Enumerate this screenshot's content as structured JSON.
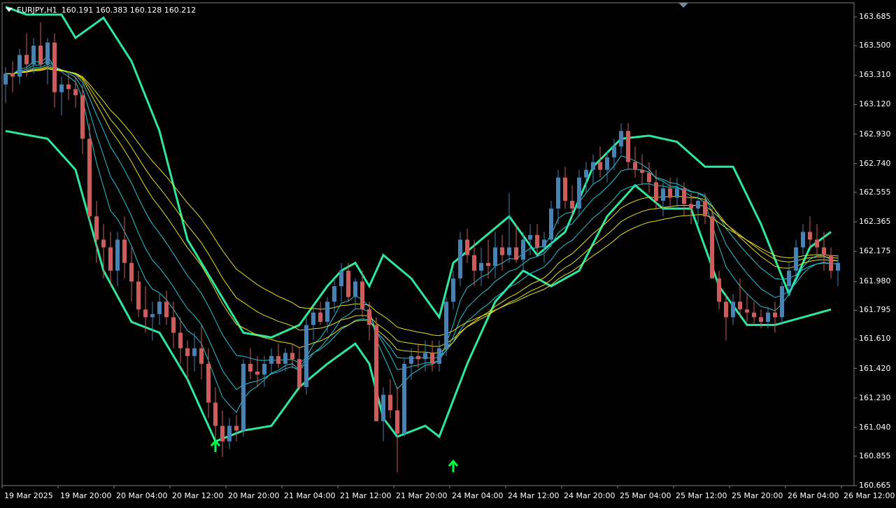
{
  "header": {
    "symbol": "EURJPY,H1",
    "ohlc": "160.191 160.383 160.128 160.212"
  },
  "colors": {
    "background": "#000000",
    "bull": "#4682b4",
    "bear": "#cd5c5c",
    "bollinger": "#2ee8a0",
    "ma_cyan": "#25c9d6",
    "ma_yellow": "#e6e020",
    "signal": "#00ff40",
    "axis": "#ffffff"
  },
  "chart_data": {
    "type": "candlestick",
    "symbol": "EURJPY",
    "timeframe": "H1",
    "ylim": [
      160.665,
      163.776
    ],
    "y_ticks": [
      "163.685",
      "163.500",
      "163.310",
      "163.120",
      "162.930",
      "162.740",
      "162.555",
      "162.365",
      "162.175",
      "161.980",
      "161.795",
      "161.610",
      "161.420",
      "161.230",
      "161.040",
      "160.855",
      "160.665"
    ],
    "x_ticks": [
      "19 Mar 2025",
      "19 Mar 20:00",
      "20 Mar 04:00",
      "20 Mar 12:00",
      "20 Mar 20:00",
      "21 Mar 04:00",
      "21 Mar 12:00",
      "21 Mar 20:00",
      "24 Mar 04:00",
      "24 Mar 12:00",
      "24 Mar 20:00",
      "25 Mar 04:00",
      "25 Mar 12:00",
      "25 Mar 20:00",
      "26 Mar 04:00",
      "26 Mar 12:00"
    ],
    "candles_ohlc": [
      [
        163.25,
        163.36,
        163.13,
        163.32
      ],
      [
        163.32,
        163.4,
        163.2,
        163.3
      ],
      [
        163.3,
        163.48,
        163.25,
        163.44
      ],
      [
        163.44,
        163.58,
        163.3,
        163.38
      ],
      [
        163.38,
        163.55,
        163.32,
        163.5
      ],
      [
        163.5,
        163.65,
        163.35,
        163.38
      ],
      [
        163.38,
        163.55,
        163.25,
        163.52
      ],
      [
        163.52,
        163.58,
        163.1,
        163.2
      ],
      [
        163.2,
        163.3,
        163.05,
        163.25
      ],
      [
        163.25,
        163.32,
        163.15,
        163.22
      ],
      [
        163.22,
        163.3,
        163.1,
        163.18
      ],
      [
        163.18,
        163.25,
        162.8,
        162.9
      ],
      [
        162.9,
        163.0,
        162.35,
        162.4
      ],
      [
        162.4,
        162.5,
        162.1,
        162.25
      ],
      [
        162.25,
        162.35,
        162.0,
        162.2
      ],
      [
        162.2,
        162.3,
        161.95,
        162.05
      ],
      [
        162.05,
        162.3,
        161.95,
        162.25
      ],
      [
        162.25,
        162.4,
        162.0,
        162.1
      ],
      [
        162.1,
        162.2,
        161.85,
        161.98
      ],
      [
        161.98,
        162.05,
        161.75,
        161.8
      ],
      [
        161.8,
        161.95,
        161.65,
        161.75
      ],
      [
        161.75,
        161.85,
        161.6,
        161.77
      ],
      [
        161.77,
        161.9,
        161.7,
        161.85
      ],
      [
        161.85,
        161.92,
        161.7,
        161.75
      ],
      [
        161.75,
        161.85,
        161.55,
        161.65
      ],
      [
        161.65,
        161.75,
        161.45,
        161.55
      ],
      [
        161.55,
        161.6,
        161.35,
        161.5
      ],
      [
        161.5,
        161.65,
        161.4,
        161.55
      ],
      [
        161.55,
        161.7,
        161.35,
        161.45
      ],
      [
        161.45,
        161.55,
        161.1,
        161.2
      ],
      [
        161.2,
        161.3,
        160.95,
        161.05
      ],
      [
        161.05,
        161.15,
        160.85,
        160.95
      ],
      [
        160.95,
        161.1,
        160.9,
        161.05
      ],
      [
        161.05,
        161.12,
        160.95,
        161.02
      ],
      [
        161.02,
        161.48,
        160.98,
        161.45
      ],
      [
        161.45,
        161.55,
        161.35,
        161.4
      ],
      [
        161.4,
        161.5,
        161.3,
        161.38
      ],
      [
        161.38,
        161.5,
        161.3,
        161.45
      ],
      [
        161.45,
        161.55,
        161.38,
        161.5
      ],
      [
        161.5,
        161.58,
        161.42,
        161.45
      ],
      [
        161.45,
        161.55,
        161.4,
        161.52
      ],
      [
        161.52,
        161.58,
        161.42,
        161.48
      ],
      [
        161.48,
        161.55,
        161.28,
        161.3
      ],
      [
        161.3,
        161.75,
        161.25,
        161.7
      ],
      [
        161.7,
        161.82,
        161.6,
        161.78
      ],
      [
        161.78,
        161.85,
        161.7,
        161.72
      ],
      [
        161.72,
        161.88,
        161.65,
        161.85
      ],
      [
        161.85,
        162.0,
        161.78,
        161.95
      ],
      [
        161.95,
        162.1,
        161.85,
        162.05
      ],
      [
        162.05,
        162.1,
        161.85,
        161.88
      ],
      [
        161.88,
        162.0,
        161.8,
        161.98
      ],
      [
        161.98,
        162.05,
        161.75,
        161.8
      ],
      [
        161.8,
        161.85,
        161.6,
        161.7
      ],
      [
        161.7,
        161.75,
        161.3,
        161.08
      ],
      [
        161.08,
        161.3,
        160.95,
        161.25
      ],
      [
        161.25,
        161.35,
        161.1,
        161.15
      ],
      [
        161.15,
        161.3,
        160.75,
        161.0
      ],
      [
        161.0,
        161.48,
        160.98,
        161.45
      ],
      [
        161.45,
        161.55,
        161.35,
        161.5
      ],
      [
        161.5,
        161.58,
        161.42,
        161.48
      ],
      [
        161.48,
        161.6,
        161.4,
        161.52
      ],
      [
        161.52,
        161.6,
        161.4,
        161.45
      ],
      [
        161.45,
        161.6,
        161.4,
        161.55
      ],
      [
        161.55,
        161.88,
        161.5,
        161.85
      ],
      [
        161.85,
        162.05,
        161.8,
        162.0
      ],
      [
        162.0,
        162.3,
        161.95,
        162.25
      ],
      [
        162.25,
        162.32,
        162.1,
        162.15
      ],
      [
        162.15,
        162.25,
        161.95,
        162.05
      ],
      [
        162.05,
        162.2,
        161.95,
        162.1
      ],
      [
        162.1,
        162.25,
        162.0,
        162.08
      ],
      [
        162.08,
        162.3,
        162.0,
        162.2
      ],
      [
        162.2,
        162.28,
        162.05,
        162.15
      ],
      [
        162.15,
        162.55,
        162.1,
        162.2
      ],
      [
        162.2,
        162.35,
        162.1,
        162.12
      ],
      [
        162.12,
        162.3,
        162.05,
        162.25
      ],
      [
        162.25,
        162.35,
        162.15,
        162.28
      ],
      [
        162.28,
        162.35,
        162.15,
        162.2
      ],
      [
        162.2,
        162.3,
        162.1,
        162.25
      ],
      [
        162.25,
        162.5,
        162.2,
        162.45
      ],
      [
        162.45,
        162.7,
        162.35,
        162.65
      ],
      [
        162.65,
        162.72,
        162.45,
        162.5
      ],
      [
        162.5,
        162.6,
        162.4,
        162.45
      ],
      [
        162.45,
        162.7,
        162.4,
        162.65
      ],
      [
        162.65,
        162.75,
        162.55,
        162.7
      ],
      [
        162.7,
        162.8,
        162.6,
        162.75
      ],
      [
        162.75,
        162.85,
        162.65,
        162.7
      ],
      [
        162.7,
        162.82,
        162.62,
        162.78
      ],
      [
        162.78,
        162.9,
        162.7,
        162.85
      ],
      [
        162.85,
        163.0,
        162.8,
        162.95
      ],
      [
        162.95,
        163.0,
        162.7,
        162.75
      ],
      [
        162.75,
        162.85,
        162.65,
        162.7
      ],
      [
        162.7,
        162.8,
        162.6,
        162.68
      ],
      [
        162.68,
        162.75,
        162.55,
        162.62
      ],
      [
        162.62,
        162.7,
        162.45,
        162.5
      ],
      [
        162.5,
        162.62,
        162.4,
        162.58
      ],
      [
        162.58,
        162.65,
        162.45,
        162.52
      ],
      [
        162.52,
        162.65,
        162.45,
        162.58
      ],
      [
        162.58,
        162.62,
        162.4,
        162.48
      ],
      [
        162.48,
        162.55,
        162.35,
        162.45
      ],
      [
        162.45,
        162.55,
        162.35,
        162.5
      ],
      [
        162.5,
        162.55,
        162.35,
        162.4
      ],
      [
        162.4,
        162.45,
        162.0,
        162.0
      ],
      [
        162.0,
        162.05,
        161.8,
        161.85
      ],
      [
        161.85,
        161.9,
        161.6,
        161.75
      ],
      [
        161.75,
        161.9,
        161.7,
        161.85
      ],
      [
        161.85,
        162.0,
        161.75,
        161.8
      ],
      [
        161.8,
        161.9,
        161.72,
        161.78
      ],
      [
        161.78,
        161.85,
        161.7,
        161.75
      ],
      [
        161.75,
        161.8,
        161.68,
        161.72
      ],
      [
        161.72,
        161.82,
        161.68,
        161.78
      ],
      [
        161.78,
        161.85,
        161.65,
        161.75
      ],
      [
        161.75,
        161.98,
        161.7,
        161.95
      ],
      [
        161.95,
        162.1,
        161.9,
        162.05
      ],
      [
        162.05,
        162.25,
        162.0,
        162.2
      ],
      [
        162.2,
        162.35,
        162.15,
        162.3
      ],
      [
        162.3,
        162.4,
        162.2,
        162.25
      ],
      [
        162.25,
        162.35,
        162.15,
        162.2
      ],
      [
        162.2,
        162.3,
        162.05,
        162.15
      ],
      [
        162.15,
        162.2,
        162.0,
        162.05
      ],
      [
        162.05,
        162.15,
        161.95,
        162.1
      ]
    ],
    "bollinger_upper": [
      [
        0,
        163.75
      ],
      [
        3,
        163.7
      ],
      [
        8,
        163.7
      ],
      [
        10,
        163.55
      ],
      [
        14,
        163.68
      ],
      [
        18,
        163.4
      ],
      [
        22,
        162.95
      ],
      [
        24,
        162.6
      ],
      [
        26,
        162.25
      ],
      [
        30,
        161.95
      ],
      [
        34,
        161.65
      ],
      [
        38,
        161.62
      ],
      [
        42,
        161.7
      ],
      [
        46,
        161.95
      ],
      [
        48,
        162.05
      ],
      [
        50,
        162.1
      ],
      [
        52,
        161.95
      ],
      [
        54,
        162.15
      ],
      [
        58,
        162.0
      ],
      [
        62,
        161.75
      ],
      [
        64,
        162.1
      ],
      [
        68,
        162.25
      ],
      [
        72,
        162.4
      ],
      [
        76,
        162.15
      ],
      [
        80,
        162.3
      ],
      [
        84,
        162.72
      ],
      [
        88,
        162.9
      ],
      [
        92,
        162.92
      ],
      [
        96,
        162.88
      ],
      [
        100,
        162.72
      ],
      [
        104,
        162.72
      ],
      [
        108,
        162.35
      ],
      [
        112,
        161.9
      ],
      [
        115,
        162.2
      ],
      [
        118,
        162.3
      ]
    ],
    "bollinger_lower": [
      [
        0,
        162.95
      ],
      [
        6,
        162.9
      ],
      [
        10,
        162.7
      ],
      [
        14,
        162.05
      ],
      [
        18,
        161.72
      ],
      [
        22,
        161.65
      ],
      [
        26,
        161.35
      ],
      [
        30,
        160.95
      ],
      [
        34,
        161.02
      ],
      [
        38,
        161.05
      ],
      [
        42,
        161.3
      ],
      [
        46,
        161.45
      ],
      [
        50,
        161.58
      ],
      [
        52,
        161.45
      ],
      [
        54,
        161.1
      ],
      [
        56,
        160.98
      ],
      [
        60,
        161.05
      ],
      [
        62,
        160.98
      ],
      [
        66,
        161.45
      ],
      [
        70,
        161.85
      ],
      [
        74,
        162.05
      ],
      [
        78,
        161.95
      ],
      [
        82,
        162.05
      ],
      [
        86,
        162.4
      ],
      [
        90,
        162.6
      ],
      [
        94,
        162.45
      ],
      [
        98,
        162.45
      ],
      [
        102,
        161.95
      ],
      [
        106,
        161.7
      ],
      [
        110,
        161.7
      ],
      [
        114,
        161.75
      ],
      [
        118,
        161.8
      ]
    ],
    "signals": [
      {
        "type": "buy-arrow",
        "candle_index": 30,
        "price": 160.98
      },
      {
        "type": "buy-arrow",
        "candle_index": 64,
        "price": 160.85
      }
    ]
  }
}
